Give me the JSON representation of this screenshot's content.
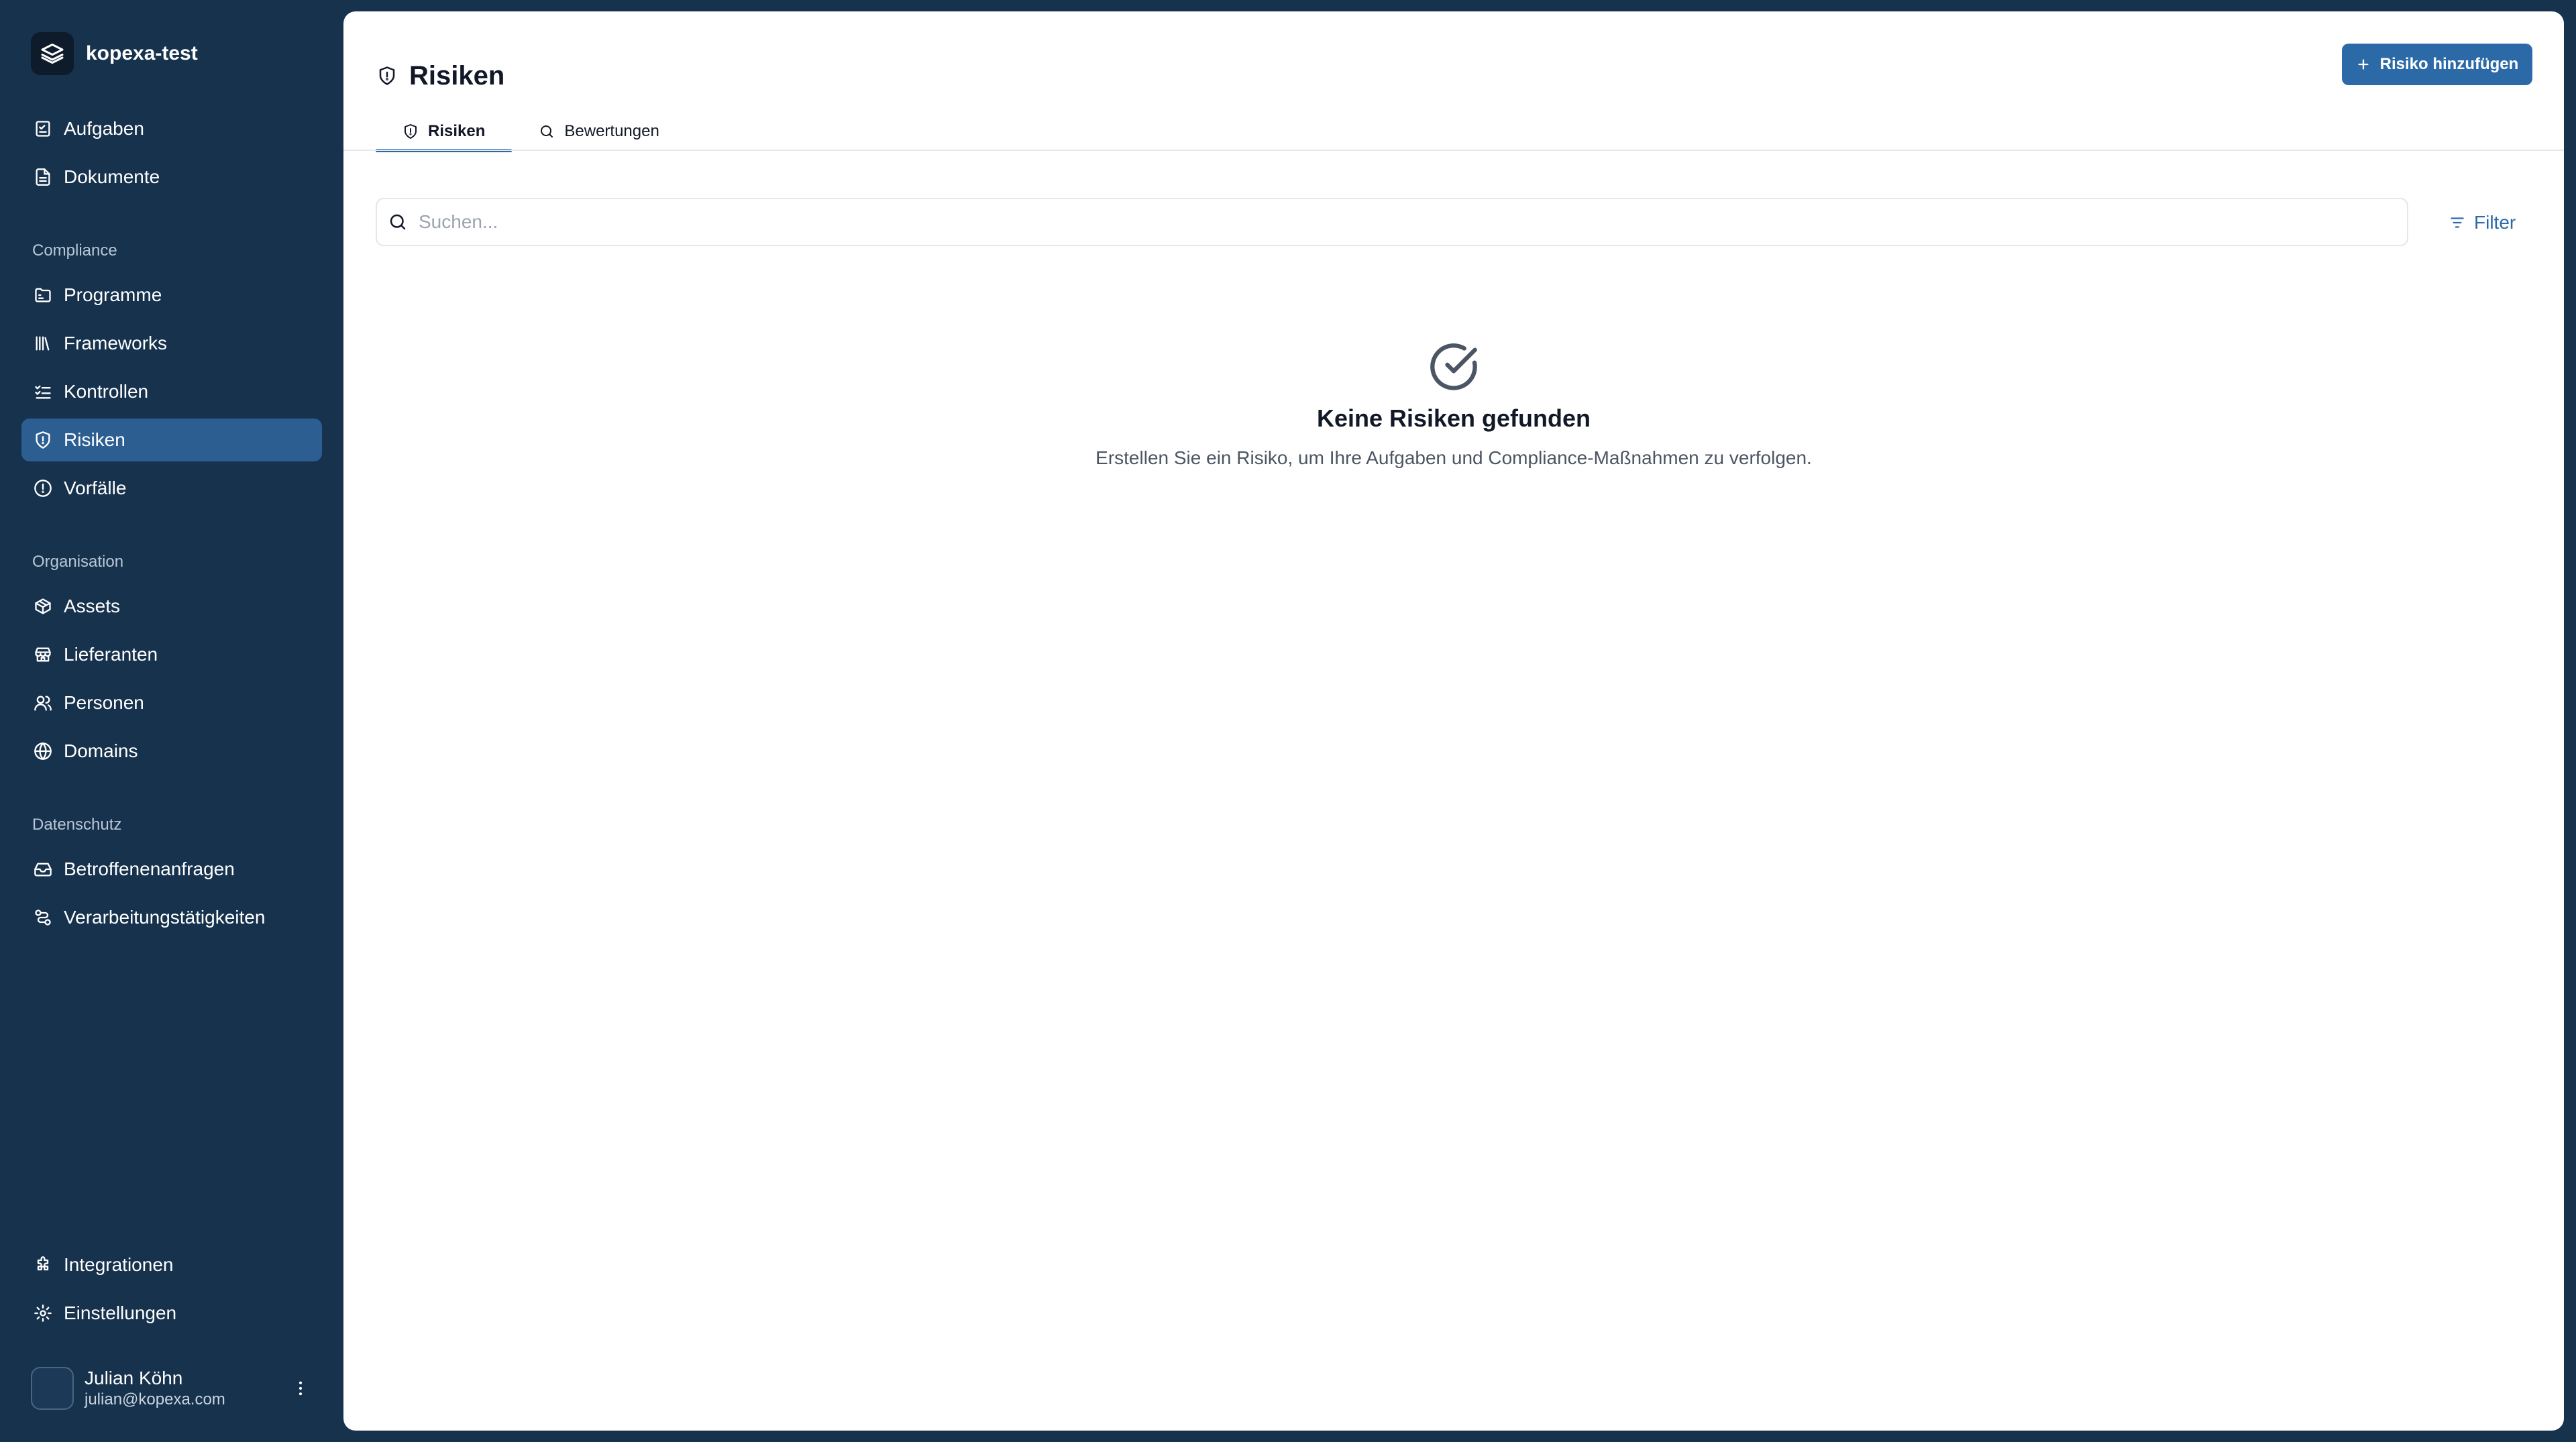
{
  "workspace": {
    "name": "kopexa-test"
  },
  "nav": {
    "top": [
      {
        "label": "Aufgaben",
        "icon": "tasks-icon"
      },
      {
        "label": "Dokumente",
        "icon": "document-icon"
      }
    ],
    "sections": [
      {
        "label": "Compliance",
        "items": [
          {
            "label": "Programme",
            "icon": "folder-icon"
          },
          {
            "label": "Frameworks",
            "icon": "library-icon"
          },
          {
            "label": "Kontrollen",
            "icon": "checklist-icon"
          },
          {
            "label": "Risiken",
            "icon": "shield-icon",
            "active": true
          },
          {
            "label": "Vorfälle",
            "icon": "alert-circle-icon"
          }
        ]
      },
      {
        "label": "Organisation",
        "items": [
          {
            "label": "Assets",
            "icon": "package-icon"
          },
          {
            "label": "Lieferanten",
            "icon": "store-icon"
          },
          {
            "label": "Personen",
            "icon": "users-icon"
          },
          {
            "label": "Domains",
            "icon": "globe-icon"
          }
        ]
      },
      {
        "label": "Datenschutz",
        "items": [
          {
            "label": "Betroffenenanfragen",
            "icon": "inbox-icon"
          },
          {
            "label": "Verarbeitungstätigkeiten",
            "icon": "route-icon"
          }
        ]
      }
    ],
    "bottom": [
      {
        "label": "Integrationen",
        "icon": "puzzle-icon"
      },
      {
        "label": "Einstellungen",
        "icon": "gear-icon"
      }
    ]
  },
  "user": {
    "name": "Julian Köhn",
    "email": "julian@kopexa.com"
  },
  "page": {
    "title": "Risiken",
    "add_button": "Risiko hinzufügen",
    "tabs": [
      {
        "label": "Risiken",
        "active": true
      },
      {
        "label": "Bewertungen",
        "active": false
      }
    ],
    "search": {
      "placeholder": "Suchen...",
      "value": ""
    },
    "filter_label": "Filter",
    "empty_state": {
      "title": "Keine Risiken gefunden",
      "description": "Erstellen Sie ein Risiko, um Ihre Aufgaben und Compliance-Maßnahmen zu verfolgen."
    }
  },
  "colors": {
    "sidebar_bg": "#17324d",
    "accent": "#2c6aa7",
    "active_nav": "#2c5e92"
  }
}
